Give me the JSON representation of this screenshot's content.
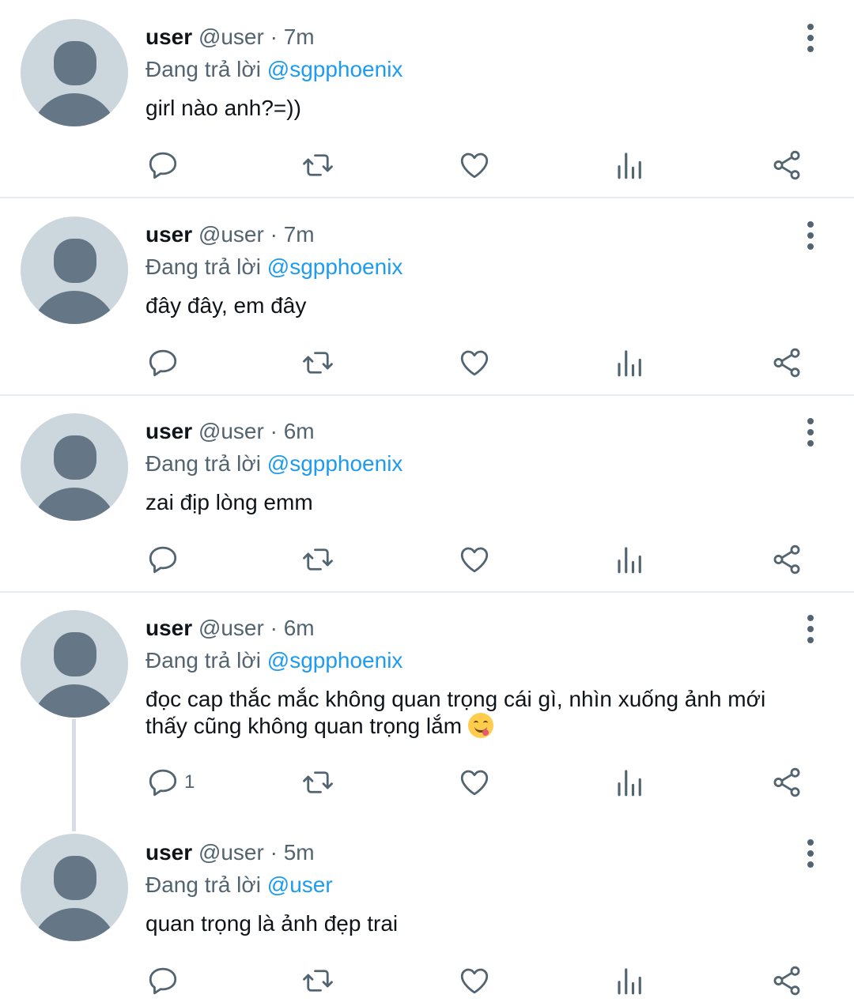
{
  "colors": {
    "mention": "#1d9bf0",
    "muted": "#536471",
    "avatar_bg": "#ccd6dd",
    "avatar_fg": "#657786"
  },
  "icons": [
    "reply-icon",
    "retweet-icon",
    "like-icon",
    "views-icon",
    "share-icon",
    "more-icon"
  ],
  "tweets": [
    {
      "name": "user",
      "handle": "@user",
      "dot": "·",
      "time": "7m",
      "reply_prefix": "Đang trả lời",
      "reply_to": "@sgpphoenix",
      "text": "girl nào anh?=))",
      "reply_count": ""
    },
    {
      "name": "user",
      "handle": "@user",
      "dot": "·",
      "time": "7m",
      "reply_prefix": "Đang trả lời",
      "reply_to": "@sgpphoenix",
      "text": "đây đây, em đây",
      "reply_count": ""
    },
    {
      "name": "user",
      "handle": "@user",
      "dot": "·",
      "time": "6m",
      "reply_prefix": "Đang trả lời",
      "reply_to": "@sgpphoenix",
      "text": "zai địp lòng emm",
      "reply_count": ""
    },
    {
      "name": "user",
      "handle": "@user",
      "dot": "·",
      "time": "6m",
      "reply_prefix": "Đang trả lời",
      "reply_to": "@sgpphoenix",
      "text": "đọc cap thắc mắc không quan trọng cái gì, nhìn xuống ảnh mới thấy cũng không quan trọng lắm",
      "emoji": "face-savoring-food-emoji",
      "reply_count": "1"
    },
    {
      "name": "user",
      "handle": "@user",
      "dot": "·",
      "time": "5m",
      "reply_prefix": "Đang trả lời",
      "reply_to": "@user",
      "text": "quan trọng là ảnh đẹp trai",
      "reply_count": ""
    }
  ]
}
